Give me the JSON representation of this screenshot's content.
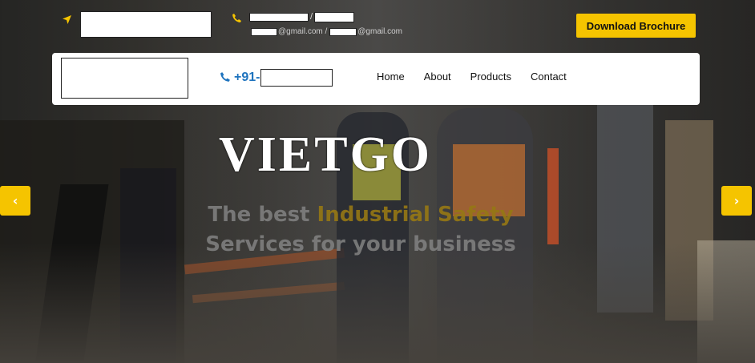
{
  "colors": {
    "accent": "#f5c400",
    "phone_blue": "#1e73be",
    "white": "#ffffff"
  },
  "topbar": {
    "location_icon": "location-arrow-icon",
    "phone_icon": "phone-icon",
    "line1_separator": "/",
    "email_suffix_1": "@gmail.com /",
    "email_suffix_2": "@gmail.com",
    "brochure_label": "Download Brochure"
  },
  "navbar": {
    "phone_prefix": "+91-",
    "phone_icon": "phone-icon",
    "menu": [
      {
        "label": "Home"
      },
      {
        "label": "About"
      },
      {
        "label": "Products"
      },
      {
        "label": "Contact"
      }
    ]
  },
  "hero": {
    "brand": "VIETGO",
    "tagline_pre": "The best ",
    "tagline_highlight": "Industrial Safety",
    "tagline_post": "Services for your business",
    "prev_arrow": "‹",
    "next_arrow": "›",
    "prev_icon": "chevron-left-icon",
    "next_icon": "chevron-right-icon"
  }
}
